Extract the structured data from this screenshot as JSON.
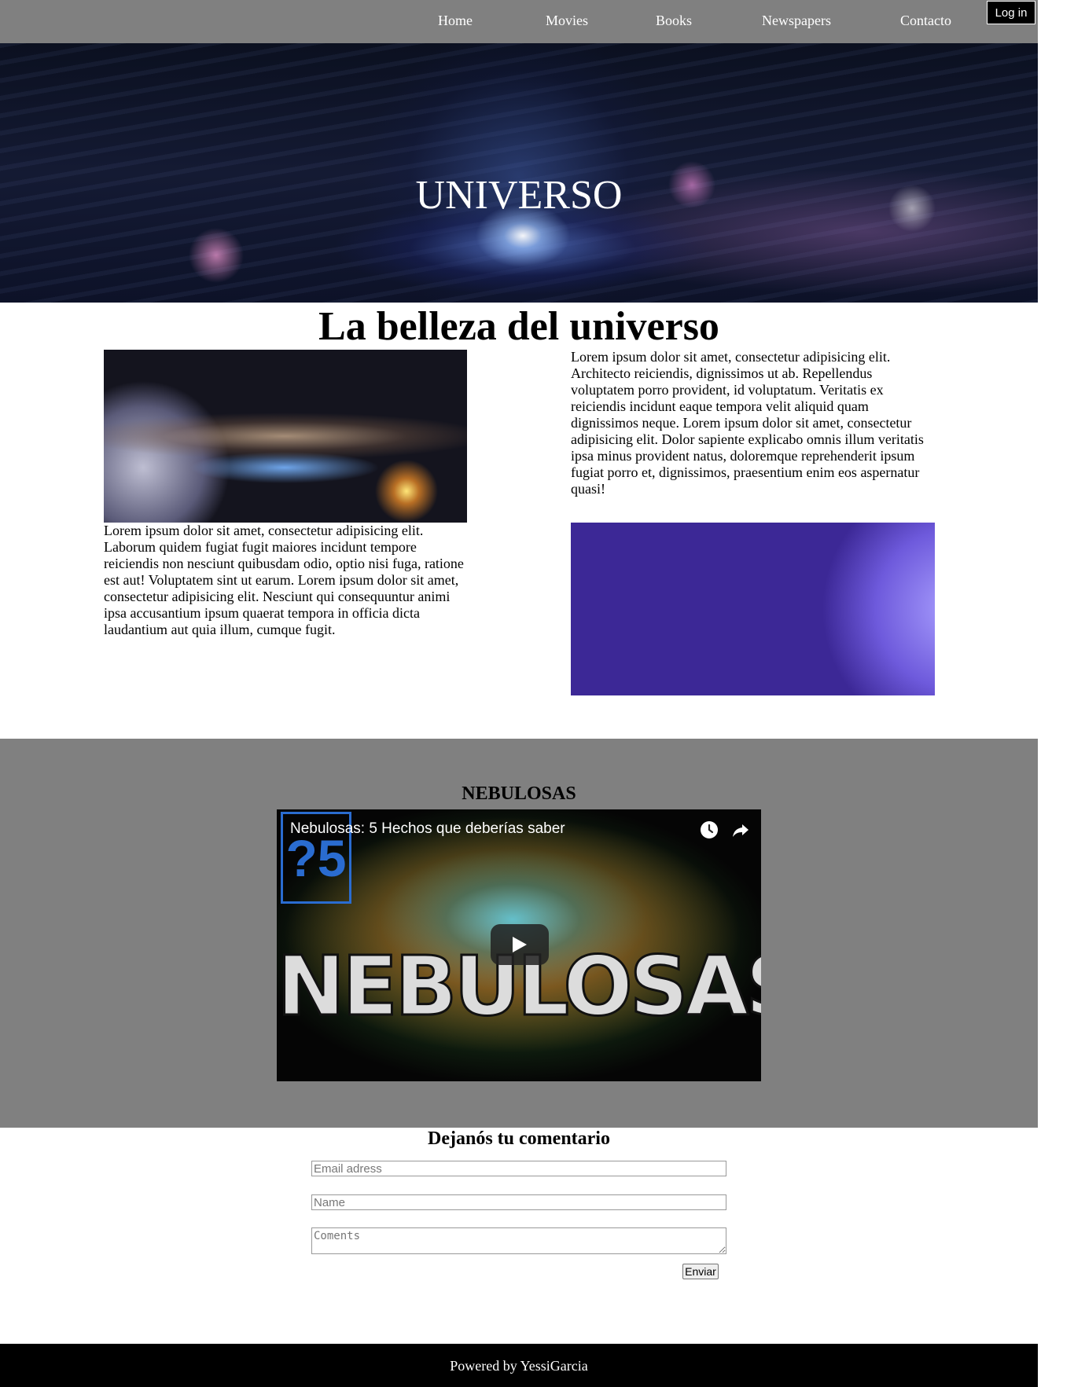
{
  "nav": {
    "items": [
      {
        "label": "Home"
      },
      {
        "label": "Movies"
      },
      {
        "label": "Books"
      },
      {
        "label": "Newspapers"
      },
      {
        "label": "Contacto"
      }
    ],
    "login_label": "Log in"
  },
  "hero": {
    "title": "UNIVERSO"
  },
  "main": {
    "title": "La belleza del universo",
    "left_text": "Lorem ipsum dolor sit amet, consectetur adipisicing elit. Laborum quidem fugiat fugit maiores incidunt tempore reiciendis non nesciunt quibusdam odio, optio nisi fuga, ratione est aut! Voluptatem sint ut earum. Lorem ipsum dolor sit amet, consectetur adipisicing elit. Nesciunt qui consequuntur animi ipsa accusantium ipsum quaerat tempora in officia dicta laudantium aut quia illum, cumque fugit.",
    "right_text": "Lorem ipsum dolor sit amet, consectetur adipisicing elit. Architecto reiciendis, dignissimos ut ab. Repellendus voluptatem porro provident, id voluptatum. Veritatis ex reiciendis incidunt eaque tempora velit aliquid quam dignissimos neque. Lorem ipsum dolor sit amet, consectetur adipisicing elit. Dolor sapiente explicabo omnis illum veritatis ipsa minus provident natus, doloremque reprehenderit ipsum fugiat porro et, dignissimos, praesentium enim eos aspernatur quasi!"
  },
  "nebulosas": {
    "title": "NEBULOSAS",
    "video": {
      "title": "Nebulosas: 5 Hechos que deberías saber",
      "logo_text": "?5",
      "overlay_text": "NEBULOSAS",
      "icons": [
        "clock-icon",
        "share-icon",
        "play-icon"
      ]
    }
  },
  "comment": {
    "title": "Dejanós tu comentario",
    "email_placeholder": "Email adress",
    "name_placeholder": "Name",
    "comments_placeholder": "Coments",
    "submit_label": "Enviar"
  },
  "footer": {
    "text": "Powered by YessiGarcia"
  },
  "colors": {
    "nav_bg": "#808080",
    "section_bg": "#808080",
    "footer_bg": "#000000",
    "login_bg": "#000000"
  }
}
